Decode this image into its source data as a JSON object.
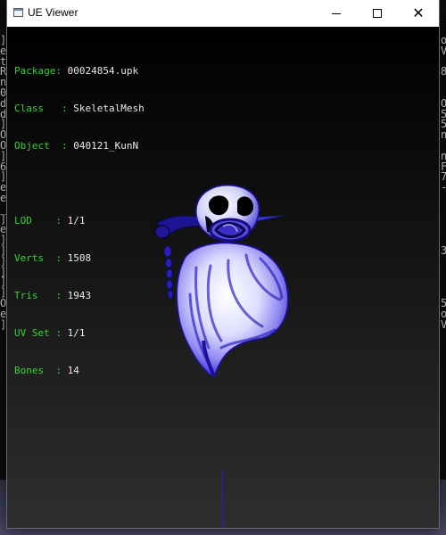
{
  "window": {
    "title": "UE Viewer",
    "icon": "app-window-icon",
    "buttons": [
      "minimize-icon",
      "maximize-icon",
      "close-icon"
    ]
  },
  "info": {
    "package_key": "Package",
    "package_value": "00024854.upk",
    "class_key": "Class",
    "class_value": "SkeletalMesh",
    "object_key": "Object",
    "object_value": "040121_KunN",
    "lod_key": "LOD",
    "lod_value": "1/1",
    "verts_key": "Verts",
    "verts_value": "1508",
    "tris_key": "Tris",
    "tris_value": "1943",
    "uvset_key": "UV Set",
    "uvset_value": "1/1",
    "bones_key": "Bones",
    "bones_value": "14"
  },
  "background_terminal": {
    "left": [
      "]",
      "e",
      "t",
      "R",
      "n",
      "0",
      "d",
      "d",
      "]",
      "O",
      "O",
      "]",
      "6",
      "]",
      "e",
      "e",
      "_",
      "]",
      "e",
      "]",
      "]",
      "]",
      "]",
      "]",
      "]",
      "O",
      "e",
      "]"
    ],
    "right": [
      "o",
      "V",
      "",
      "8",
      "",
      "",
      "O",
      "5",
      "5",
      "n",
      "",
      "n",
      "F",
      "7",
      "-",
      "",
      "",
      "",
      "",
      "",
      "3",
      "",
      "",
      "",
      "",
      "5",
      "o",
      "V"
    ]
  },
  "colors": {
    "label_green": "#34d634",
    "value_white": "#e8e8e8",
    "mesh_blue": "#2a1fd0",
    "axis_blue": "#1c24d8"
  }
}
